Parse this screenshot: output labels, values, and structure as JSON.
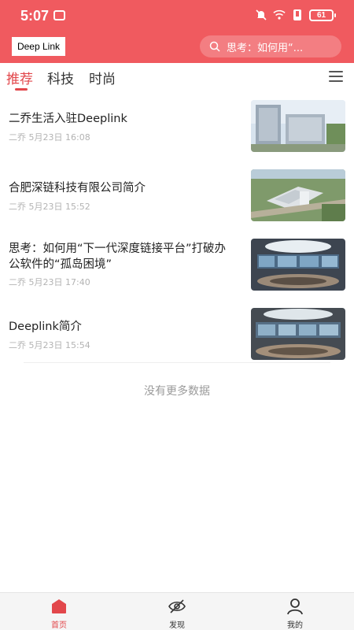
{
  "status_bar": {
    "time": "5:07",
    "battery": "61"
  },
  "header": {
    "logo_text": "Deep Link",
    "search_placeholder": "思考：如何用“...",
    "accent_color": "#f05a5f"
  },
  "tabs": [
    {
      "label": "推荐",
      "active": true
    },
    {
      "label": "科技",
      "active": false
    },
    {
      "label": "时尚",
      "active": false
    }
  ],
  "news": [
    {
      "title": "二乔生活入驻Deeplink",
      "source": "二乔",
      "date": "5月23日 16:08",
      "thumb": "buildings"
    },
    {
      "title": "合肥深链科技有限公司简介",
      "source": "二乔",
      "date": "5月23日 15:52",
      "thumb": "aerial"
    },
    {
      "title": "思考：如何用“下一代深度链接平台”打破办公软件的“孤岛困境”",
      "source": "二乔",
      "date": "5月23日 17:40",
      "thumb": "control-room"
    },
    {
      "title": "Deeplink简介",
      "source": "二乔",
      "date": "5月23日 15:54",
      "thumb": "control-room"
    }
  ],
  "no_more_text": "没有更多数据",
  "bottom_nav": [
    {
      "label": "首页",
      "icon": "home-icon",
      "active": true
    },
    {
      "label": "发现",
      "icon": "eye-slash-icon",
      "active": false
    },
    {
      "label": "我的",
      "icon": "user-icon",
      "active": false
    }
  ]
}
